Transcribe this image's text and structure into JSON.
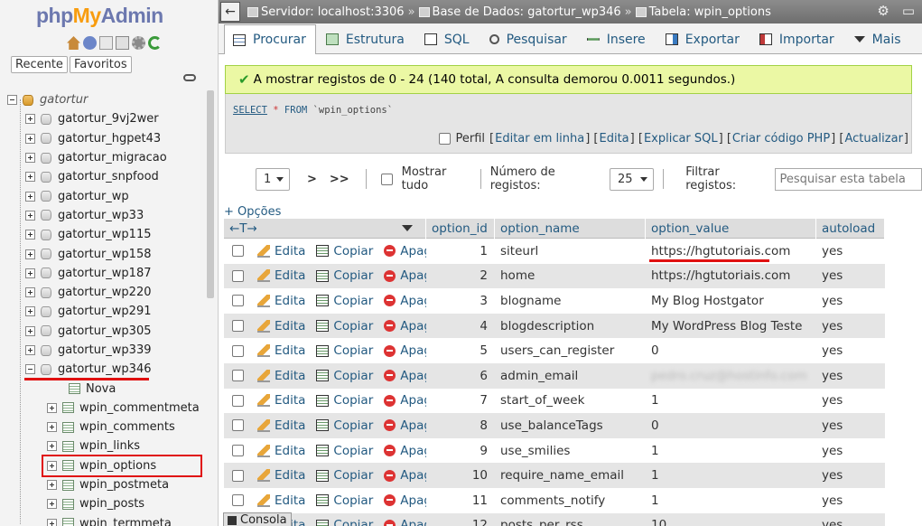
{
  "logo": {
    "php": "php",
    "my": "My",
    "admin": "Admin"
  },
  "nav": {
    "tabs": [
      "Recente",
      "Favoritos"
    ],
    "root_db": "gatortur",
    "databases": [
      "gatortur_9vj2wer",
      "gatortur_hgpet43",
      "gatortur_migracao",
      "gatortur_snpfood",
      "gatortur_wp",
      "gatortur_wp33",
      "gatortur_wp115",
      "gatortur_wp158",
      "gatortur_wp187",
      "gatortur_wp220",
      "gatortur_wp291",
      "gatortur_wp305",
      "gatortur_wp339"
    ],
    "open_db": "gatortur_wp346",
    "new_label": "Nova",
    "tables": [
      "wpin_commentmeta",
      "wpin_comments",
      "wpin_links",
      "wpin_options",
      "wpin_postmeta",
      "wpin_posts",
      "wpin_termmeta"
    ]
  },
  "breadcrumb": {
    "server": "Servidor: localhost:3306",
    "database": "Base de Dados: gatortur_wp346",
    "table": "Tabela: wpin_options"
  },
  "tabs": [
    "Procurar",
    "Estrutura",
    "SQL",
    "Pesquisar",
    "Insere",
    "Exportar",
    "Importar",
    "Mais"
  ],
  "success_message": "A mostrar registos de 0 - 24 (140 total, A consulta demorou 0.0011 segundos.)",
  "sql": {
    "select": "SELECT",
    "star": "*",
    "from": "FROM",
    "table": "`wpin_options`"
  },
  "profiling": {
    "label": "Perfil",
    "links": [
      "Editar em linha",
      "Edita",
      "Explicar SQL",
      "Criar código PHP",
      "Actualizar"
    ]
  },
  "pager": {
    "page": "1",
    "next": ">",
    "last": ">>",
    "show_all": "Mostrar tudo",
    "rows_label": "Número de registos:",
    "rows_value": "25",
    "filter_label": "Filtrar registos:",
    "filter_placeholder": "Pesquisar esta tabela"
  },
  "options_link": "+ Opções",
  "lr_arrows": "←T→",
  "columns": [
    "option_id",
    "option_name",
    "option_value",
    "autoload"
  ],
  "actions": {
    "edit": "Edita",
    "copy": "Copiar",
    "delete": "Apagar"
  },
  "rows": [
    {
      "id": "1",
      "name": "siteurl",
      "value": "https://hgtutoriais.com",
      "autoload": "yes"
    },
    {
      "id": "2",
      "name": "home",
      "value": "https://hgtutoriais.com",
      "autoload": "yes"
    },
    {
      "id": "3",
      "name": "blogname",
      "value": "My Blog Hostgator",
      "autoload": "yes"
    },
    {
      "id": "4",
      "name": "blogdescription",
      "value": "My WordPress Blog Teste",
      "autoload": "yes"
    },
    {
      "id": "5",
      "name": "users_can_register",
      "value": "0",
      "autoload": "yes"
    },
    {
      "id": "6",
      "name": "admin_email",
      "value": "pedro.cruz@hostinfo.com",
      "autoload": "yes"
    },
    {
      "id": "7",
      "name": "start_of_week",
      "value": "1",
      "autoload": "yes"
    },
    {
      "id": "8",
      "name": "use_balanceTags",
      "value": "0",
      "autoload": "yes"
    },
    {
      "id": "9",
      "name": "use_smilies",
      "value": "1",
      "autoload": "yes"
    },
    {
      "id": "10",
      "name": "require_name_email",
      "value": "1",
      "autoload": "yes"
    },
    {
      "id": "11",
      "name": "comments_notify",
      "value": "1",
      "autoload": "yes"
    },
    {
      "id": "12",
      "name": "posts_per_rss",
      "value": "10",
      "autoload": "yes"
    }
  ],
  "console": "Consola"
}
